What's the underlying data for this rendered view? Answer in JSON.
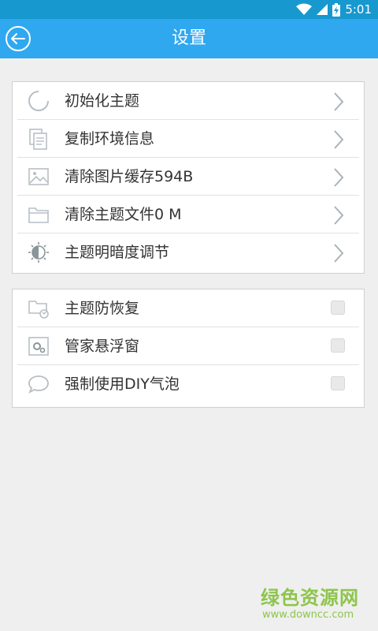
{
  "status_bar": {
    "time": "5:01",
    "wifi_icon": "wifi-icon",
    "signal_icon": "signal-icon",
    "battery_icon": "battery-charging-icon"
  },
  "app_bar": {
    "title": "设置",
    "back_icon": "back-arrow-icon"
  },
  "settings_group": [
    {
      "label": "初始化主题",
      "icon": "refresh-circle-icon",
      "action": "chevron-right-icon"
    },
    {
      "label": "复制环境信息",
      "icon": "copy-document-icon",
      "action": "chevron-right-icon"
    },
    {
      "label": "清除图片缓存594B",
      "icon": "image-icon",
      "action": "chevron-right-icon"
    },
    {
      "label": "清除主题文件0 M",
      "icon": "folder-icon",
      "action": "chevron-right-icon"
    },
    {
      "label": "主题明暗度调节",
      "icon": "brightness-icon",
      "action": "chevron-right-icon"
    }
  ],
  "toggle_group": [
    {
      "label": "主题防恢复",
      "icon": "folder-restore-icon",
      "checked": false
    },
    {
      "label": "管家悬浮窗",
      "icon": "gear-window-icon",
      "checked": false
    },
    {
      "label": "强制使用DIY气泡",
      "icon": "speech-bubble-icon",
      "checked": false
    }
  ],
  "watermark": {
    "title": "绿色资源网",
    "url": "www.downcc.com"
  },
  "colors": {
    "status_bar": "#1798cf",
    "app_bar": "#2fa8f0",
    "watermark": "#8dc54b"
  }
}
